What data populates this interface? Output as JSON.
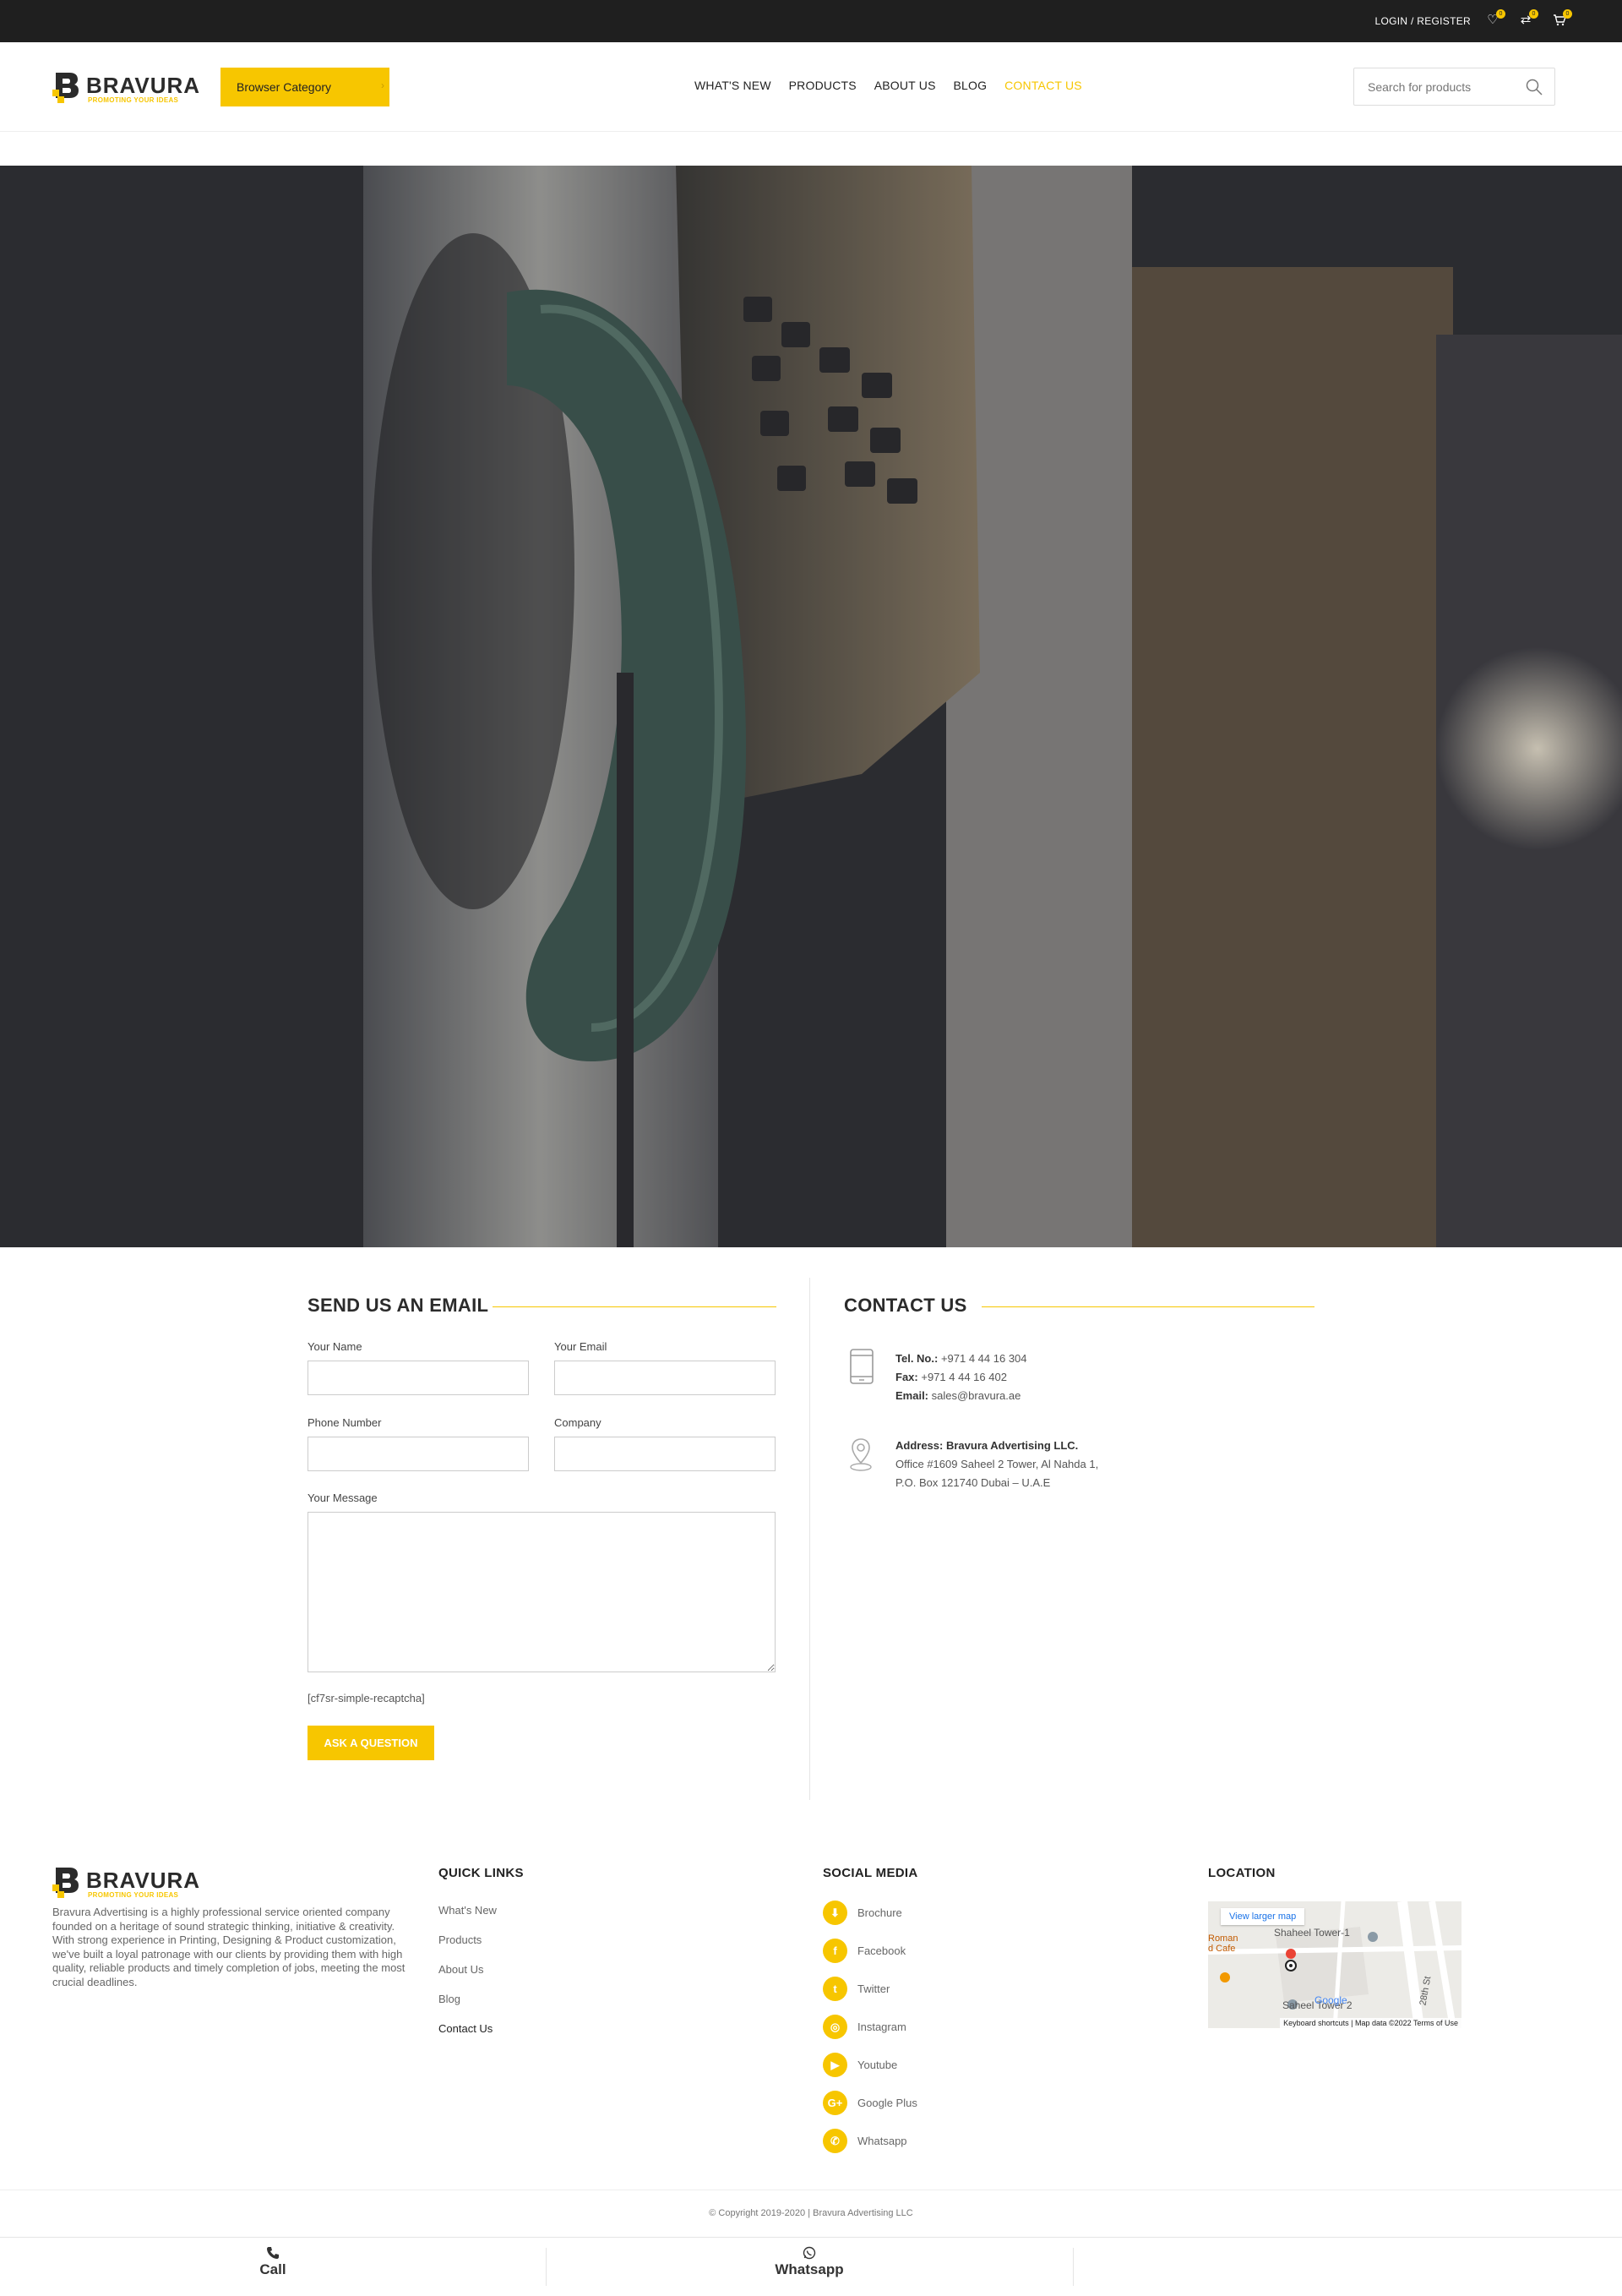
{
  "topbar": {
    "login_label": "LOGIN / REGISTER",
    "wishlist_count": "0",
    "compare_count": "0",
    "cart_count": "0"
  },
  "header": {
    "logo_word": "BRAVURA",
    "logo_tagline": "PROMOTING YOUR IDEAS",
    "category_button": "Browser Category",
    "nav": [
      "WHAT'S NEW",
      "PRODUCTS",
      "ABOUT US",
      "BLOG",
      "CONTACT US"
    ],
    "active_nav": "CONTACT US",
    "search_placeholder": "Search for products"
  },
  "email_form": {
    "title": "SEND US AN EMAIL",
    "name_label": "Your Name",
    "email_label": "Your Email",
    "phone_label": "Phone Number",
    "company_label": "Company",
    "message_label": "Your Message",
    "captcha_text": "[cf7sr-simple-recaptcha]",
    "submit_label": "ASK A QUESTION"
  },
  "contact": {
    "title": "CONTACT US",
    "tel_label": "Tel. No.:",
    "tel_value": "+971 4 44 16 304",
    "fax_label": "Fax:",
    "fax_value": "+971 4 44 16 402",
    "email_label": "Email:",
    "email_value": "sales@bravura.ae",
    "address_label": "Address:",
    "address_name": "Bravura Advertising LLC.",
    "address_line1": "Office #1609 Saheel 2 Tower, Al Nahda 1,",
    "address_line2": "P.O. Box 121740 Dubai – U.A.E"
  },
  "footer": {
    "about": "Bravura Advertising is a highly professional service oriented company founded on a heritage of sound strategic thinking, initiative & creativity. With strong experience in Printing, Designing & Product customization, we've built a loyal patronage with our clients by providing them with high quality, reliable products and timely completion of jobs, meeting the most crucial deadlines.",
    "quick_links_title": "QUICK LINKS",
    "quick_links": [
      "What's New",
      "Products",
      "About Us",
      "Blog",
      "Contact Us"
    ],
    "social_title": "SOCIAL MEDIA",
    "social": [
      "Brochure",
      "Facebook",
      "Twitter",
      "Instagram",
      "Youtube",
      "Google Plus",
      "Whatsapp"
    ],
    "location_title": "LOCATION",
    "map": {
      "view_larger": "View larger map",
      "place1": "Shaheel Tower-1",
      "place2": "Saheel Tower 2",
      "street": "28th St",
      "cafe": "Roman\nd Cafe",
      "attribution": "Keyboard shortcuts | Map data ©2022   Terms of Use",
      "google": "Google"
    },
    "copyright": "© Copyright 2019-2020 | Bravura Advertising LLC"
  },
  "bottom_bar": {
    "call": "Call",
    "whatsapp": "Whatsapp"
  },
  "colors": {
    "accent": "#f7c600",
    "topbar": "#1f1f1f"
  }
}
